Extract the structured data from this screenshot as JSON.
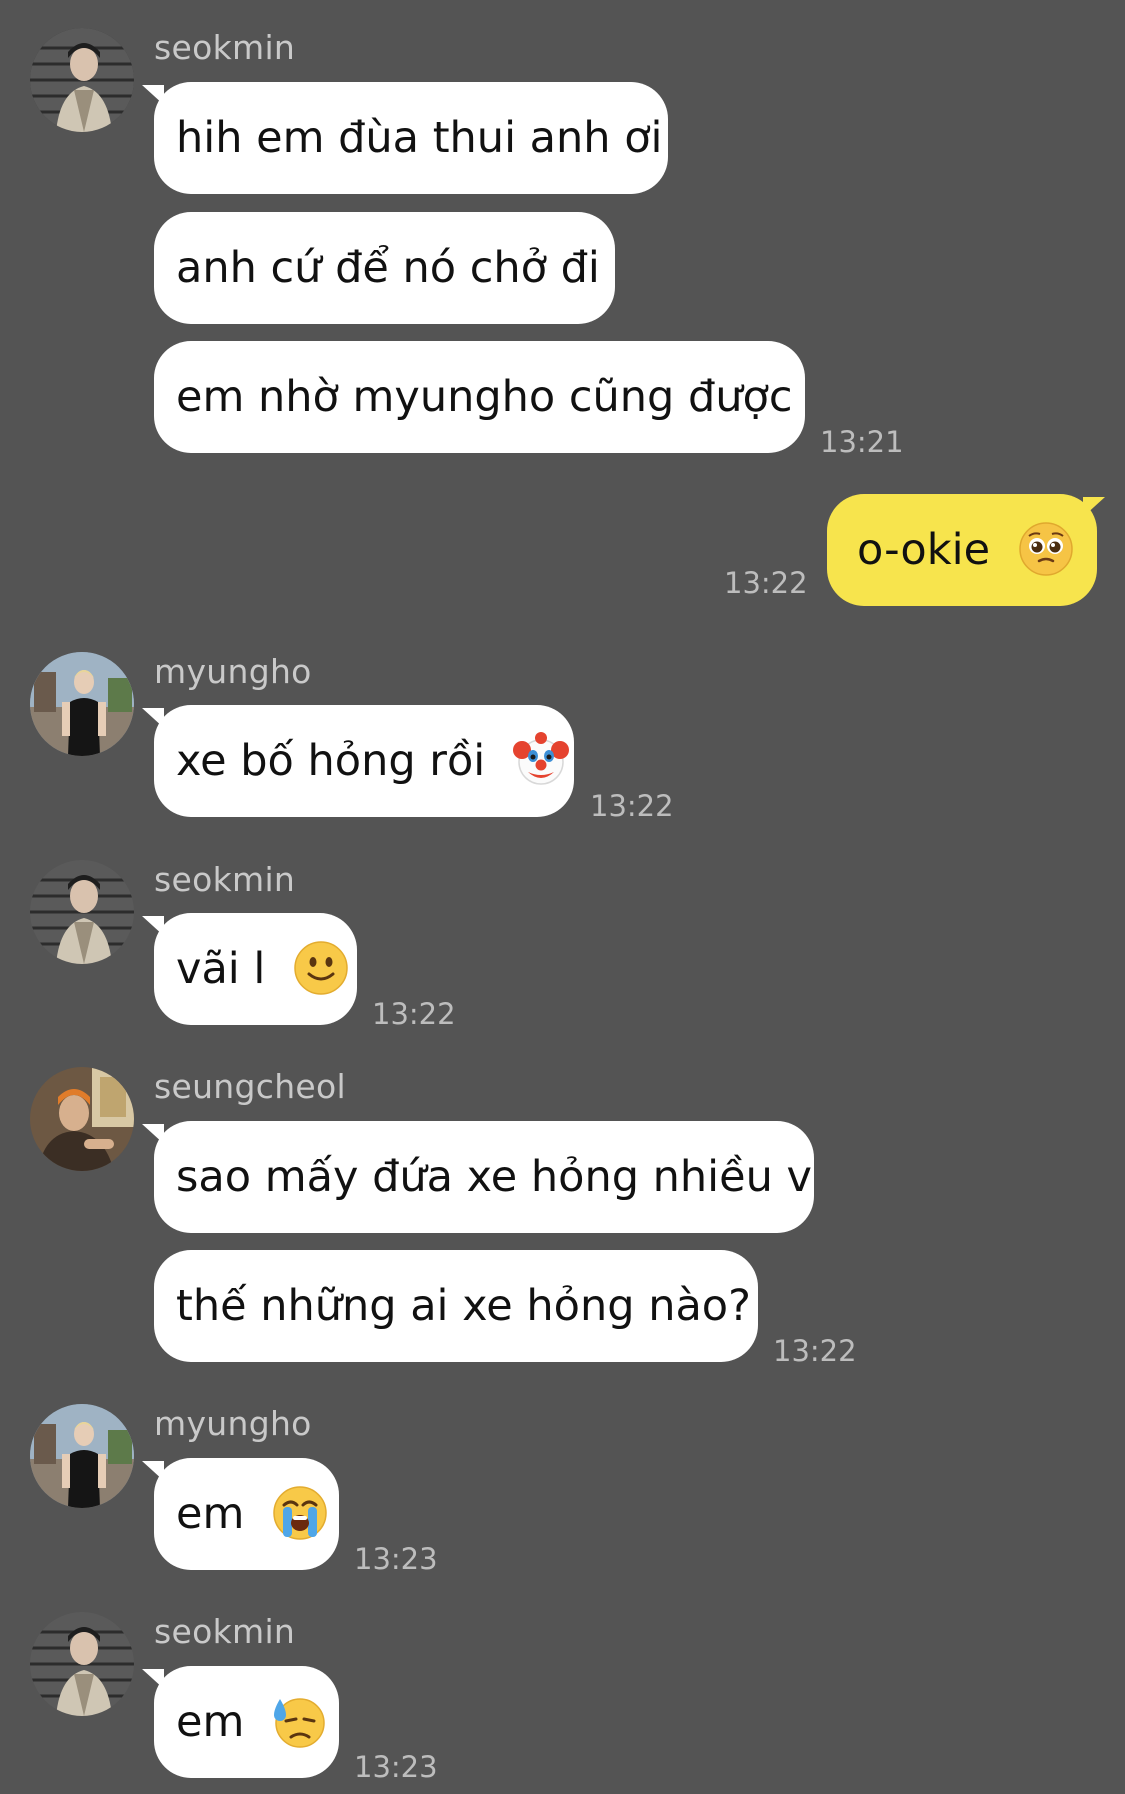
{
  "colors": {
    "background": "#545454",
    "bubble_in": "#ffffff",
    "bubble_out": "#f7e44d",
    "sender_name": "#c9c9c9",
    "timestamp": "#bdbdbd"
  },
  "groups": [
    {
      "sender": "seokmin",
      "avatar_icon": "avatar-seokmin",
      "messages": [
        "hih em đùa thui anh ơi",
        "anh cứ để nó chở đi",
        "em nhờ myungho cũng được"
      ],
      "time": "13:21"
    },
    {
      "sender": "me",
      "messages": [
        "o-okie"
      ],
      "emoji_icon": "pleading-face-icon",
      "time": "13:22"
    },
    {
      "sender": "myungho",
      "avatar_icon": "avatar-myungho",
      "messages": [
        "xe bố hỏng rồi"
      ],
      "emoji_icon": "clown-face-icon",
      "time": "13:22"
    },
    {
      "sender": "seokmin",
      "avatar_icon": "avatar-seokmin",
      "messages": [
        "vãi l"
      ],
      "emoji_icon": "slightly-smiling-face-icon",
      "time": "13:22"
    },
    {
      "sender": "seungcheol",
      "avatar_icon": "avatar-seungcheol",
      "messages": [
        "sao mấy đứa xe hỏng nhiều v",
        "thế những ai xe hỏng nào?"
      ],
      "time": "13:22"
    },
    {
      "sender": "myungho",
      "avatar_icon": "avatar-myungho",
      "messages": [
        "em"
      ],
      "emoji_icon": "loudly-crying-face-icon",
      "time": "13:23"
    },
    {
      "sender": "seokmin",
      "avatar_icon": "avatar-seokmin",
      "messages": [
        "em"
      ],
      "emoji_icon": "downcast-face-sweat-icon",
      "time": "13:23"
    }
  ]
}
